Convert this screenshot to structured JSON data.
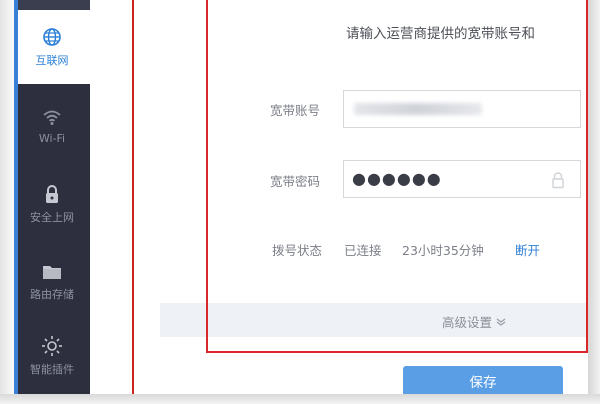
{
  "sidebar": {
    "items": [
      {
        "label": "互联网",
        "icon": "globe-icon",
        "active": true
      },
      {
        "label": "Wi-Fi",
        "icon": "wifi-icon",
        "active": false
      },
      {
        "label": "安全上网",
        "icon": "lock-icon",
        "active": false
      },
      {
        "label": "路由存储",
        "icon": "folder-icon",
        "active": false
      },
      {
        "label": "智能插件",
        "icon": "bulb-icon",
        "active": false
      }
    ]
  },
  "main": {
    "hint": "请输入运营商提供的宽带账号和",
    "account": {
      "label": "宽带账号",
      "value": ""
    },
    "password": {
      "label": "宽带密码",
      "value": "●●●●●●"
    },
    "status": {
      "label": "拨号状态",
      "state": "已连接",
      "duration": "23小时35分钟",
      "disconnect": "断开"
    },
    "advanced": "高级设置",
    "save": "保存"
  },
  "colors": {
    "accent": "#2b7fd6",
    "sidebar_bg": "#2d2f3e",
    "highlight_border": "#d8282a",
    "button": "#5a9ee6"
  }
}
